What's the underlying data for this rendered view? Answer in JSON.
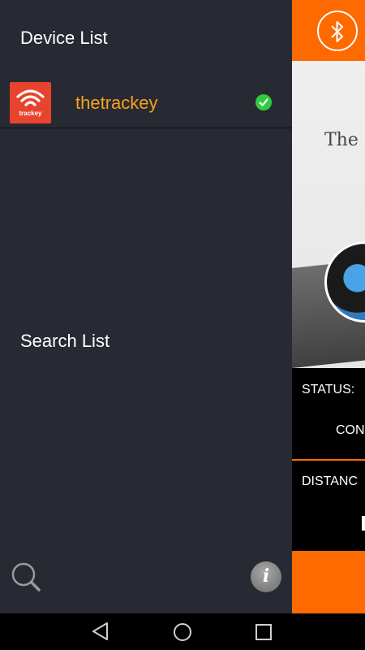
{
  "drawer": {
    "device_list_title": "Device List",
    "devices": [
      {
        "name": "thetrackey",
        "logo_text": "trackey",
        "connected": true
      }
    ],
    "search_list_title": "Search List",
    "info_label": "i"
  },
  "main": {
    "hero_text": "The c",
    "status_label": "STATUS:",
    "status_value": "CON",
    "distance_label": "DISTANC"
  },
  "colors": {
    "accent": "#ff6a00",
    "drawer_bg": "#282a33",
    "device_name": "#f7a21b",
    "connected": "#2ecc40"
  }
}
